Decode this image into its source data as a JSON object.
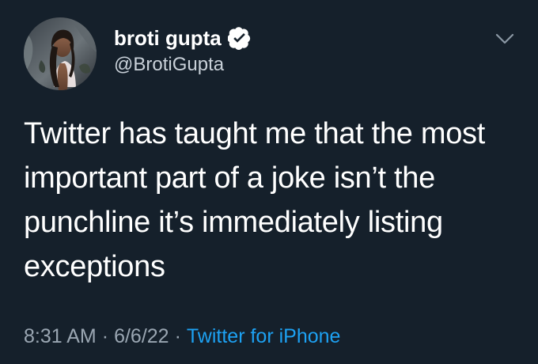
{
  "author": {
    "display_name": "broti gupta",
    "handle": "@BrotiGupta",
    "verified": true
  },
  "tweet": {
    "text": "Twitter has taught me that the most\nimportant part of a joke isn’t the\npunchline it’s immediately listing\nexceptions"
  },
  "meta": {
    "time": "8:31 AM",
    "separator": "·",
    "date": "6/6/22",
    "source": "Twitter for iPhone"
  },
  "icons": {
    "verified": "verified-badge-icon",
    "menu": "chevron-down-icon"
  },
  "colors": {
    "background": "#15202b",
    "text": "#ffffff",
    "secondary_text": "#9aa6b2",
    "link": "#1da1f2"
  }
}
